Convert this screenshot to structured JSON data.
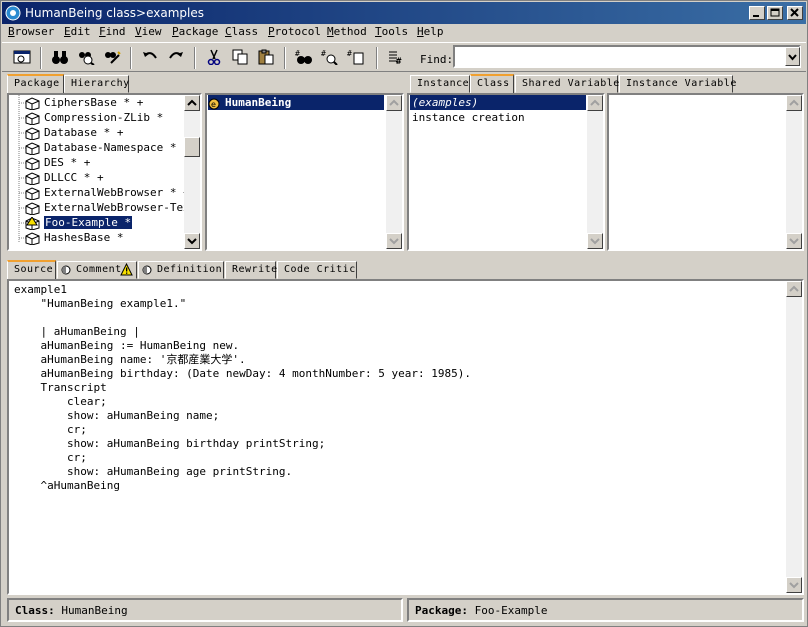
{
  "window": {
    "title": "HumanBeing class>examples"
  },
  "menu": [
    "Browser",
    "Edit",
    "Find",
    "View",
    "Package",
    "Class",
    "Protocol",
    "Method",
    "Tools",
    "Help"
  ],
  "toolbar": {
    "find_label": "Find:",
    "find_value": ""
  },
  "package_tabs": [
    "Package",
    "Hierarchy"
  ],
  "packages": [
    "CiphersBase * +",
    "Compression-ZLib *",
    "Database * +",
    "Database-Namespace *",
    "DES * +",
    "DLLCC * +",
    "ExternalWebBrowser * +",
    "ExternalWebBrowser-Text",
    "Foo-Example *",
    "HashesBase *"
  ],
  "selected_package": "Foo-Example *",
  "classes": [
    "HumanBeing"
  ],
  "class_side_tabs": [
    "Instance",
    "Class",
    "Shared Variable",
    "Instance Variable"
  ],
  "protocols": [
    "(examples)",
    "instance creation"
  ],
  "code_tabs": [
    "Source",
    "Comment",
    "Definition",
    "Rewrite",
    "Code Critic"
  ],
  "source_lines": [
    "example1",
    "    \"HumanBeing example1.\"",
    "",
    "    | aHumanBeing |",
    "    aHumanBeing := HumanBeing new.",
    "    aHumanBeing name: '京都産業大学'.",
    "    aHumanBeing birthday: (Date newDay: 4 monthNumber: 5 year: 1985).",
    "    Transcript",
    "        clear;",
    "        show: aHumanBeing name;",
    "        cr;",
    "        show: aHumanBeing birthday printString;",
    "        cr;",
    "        show: aHumanBeing age printString.",
    "    ^aHumanBeing"
  ],
  "status": {
    "class_label": "Class:",
    "class_value": "HumanBeing",
    "package_label": "Package:",
    "package_value": "Foo-Example"
  }
}
